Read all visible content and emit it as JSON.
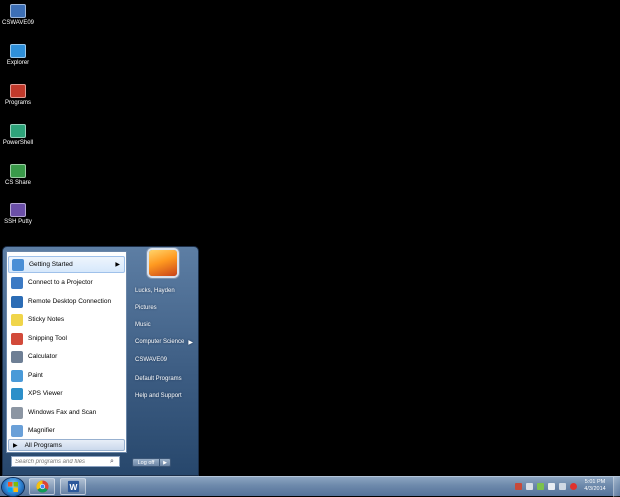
{
  "desktop": {
    "icons": [
      {
        "label": "CSWAVE09",
        "icon": "network-drive-icon",
        "color": "#3d6fb5"
      },
      {
        "label": "Explorer",
        "icon": "explorer-icon",
        "color": "#2f8fd8"
      },
      {
        "label": "Programs",
        "icon": "programs-folder-icon",
        "color": "#c0392b"
      },
      {
        "label": "PowerShell",
        "icon": "powershell-icon",
        "color": "#2ea37a"
      },
      {
        "label": "CS Share",
        "icon": "share-folder-icon",
        "color": "#3a9a4a"
      },
      {
        "label": "SSH Putty",
        "icon": "putty-icon",
        "color": "#6b4fa8"
      }
    ]
  },
  "start_menu": {
    "programs": [
      {
        "label": "Getting Started",
        "icon": "getting-started-icon",
        "color": "#4a8fd6",
        "has_submenu": true
      },
      {
        "label": "Connect to a Projector",
        "icon": "projector-icon",
        "color": "#3c7ac4"
      },
      {
        "label": "Remote Desktop Connection",
        "icon": "remote-desktop-icon",
        "color": "#2b6cb5"
      },
      {
        "label": "Sticky Notes",
        "icon": "sticky-notes-icon",
        "color": "#f0d54a"
      },
      {
        "label": "Snipping Tool",
        "icon": "scissors-icon",
        "color": "#d24a3a"
      },
      {
        "label": "Calculator",
        "icon": "calculator-icon",
        "color": "#6e7f95"
      },
      {
        "label": "Paint",
        "icon": "paint-icon",
        "color": "#4a9ad8"
      },
      {
        "label": "XPS Viewer",
        "icon": "xps-viewer-icon",
        "color": "#2c8fc9"
      },
      {
        "label": "Windows Fax and Scan",
        "icon": "fax-scan-icon",
        "color": "#8c96a3"
      },
      {
        "label": "Magnifier",
        "icon": "magnifier-icon",
        "color": "#6aa0d8"
      }
    ],
    "all_programs_label": "All Programs",
    "search_placeholder": "Search programs and files",
    "right_items": [
      {
        "label": "Lucks, Hayden",
        "has_submenu": false
      },
      {
        "label": "Pictures",
        "has_submenu": false
      },
      {
        "label": "Music",
        "has_submenu": false
      },
      {
        "label": "Computer Science",
        "has_submenu": true
      },
      {
        "label": "CSWAVE09",
        "has_submenu": false
      },
      {
        "label": "Default Programs",
        "has_submenu": false
      },
      {
        "label": "Help and Support",
        "has_submenu": false
      }
    ],
    "logoff_label": "Log off"
  },
  "taskbar": {
    "pinned": [
      {
        "name": "chrome-taskbar-button",
        "icon": "chrome-icon"
      },
      {
        "name": "word-taskbar-button",
        "icon": "word-icon"
      }
    ],
    "clock_time": "5:01 PM",
    "clock_date": "4/3/2014"
  }
}
